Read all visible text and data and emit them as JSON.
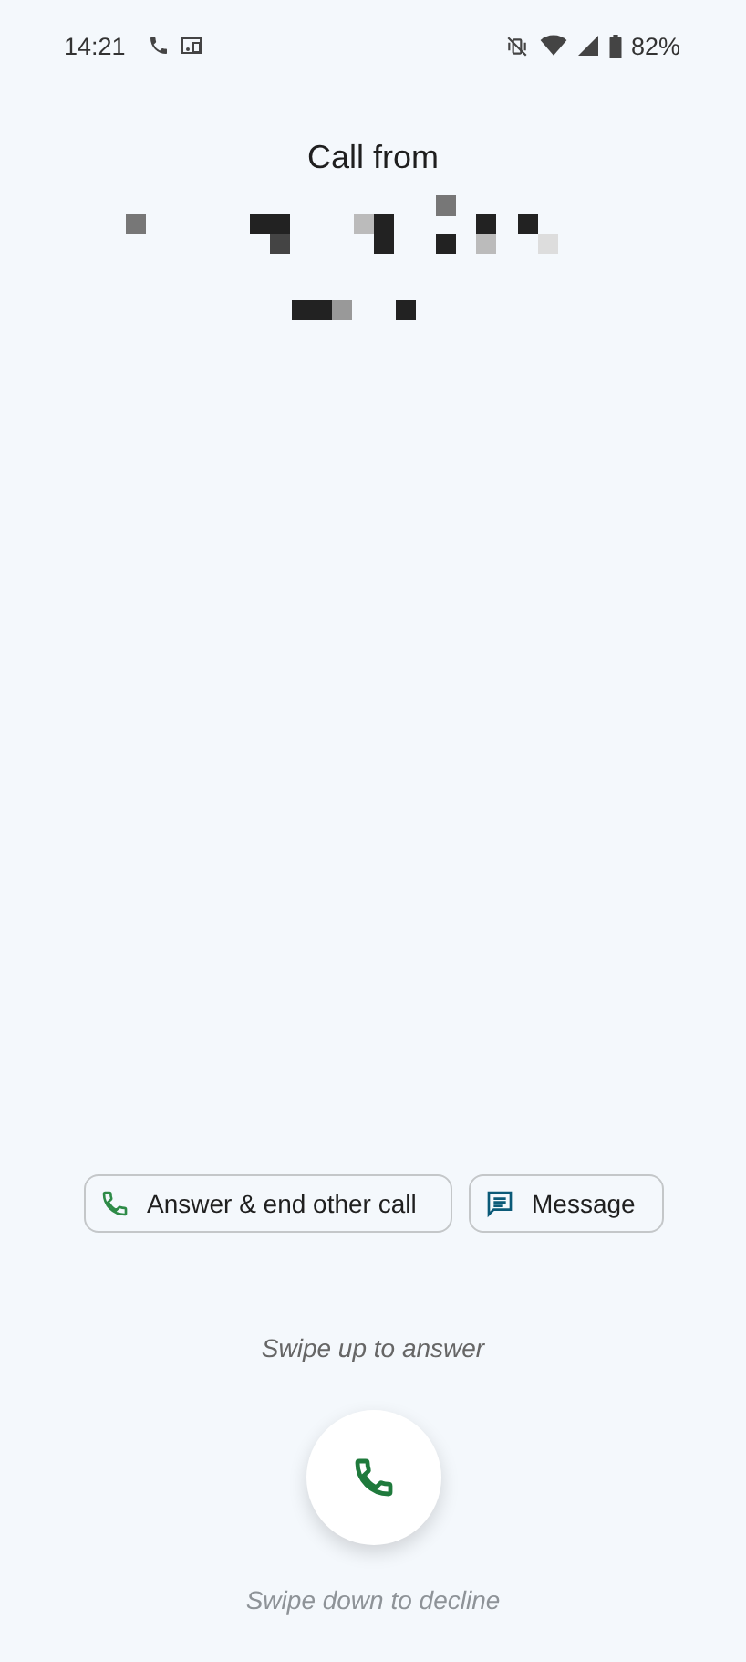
{
  "status_bar": {
    "time": "14:21",
    "battery": "82%"
  },
  "caller": {
    "label": "Call from"
  },
  "actions": [
    {
      "kind": "answer_end",
      "label": "Answer & end other call"
    },
    {
      "kind": "message",
      "label": "Message"
    }
  ],
  "swipe_up_hint": "Swipe up to answer",
  "swipe_down_hint": "Swipe down to decline"
}
